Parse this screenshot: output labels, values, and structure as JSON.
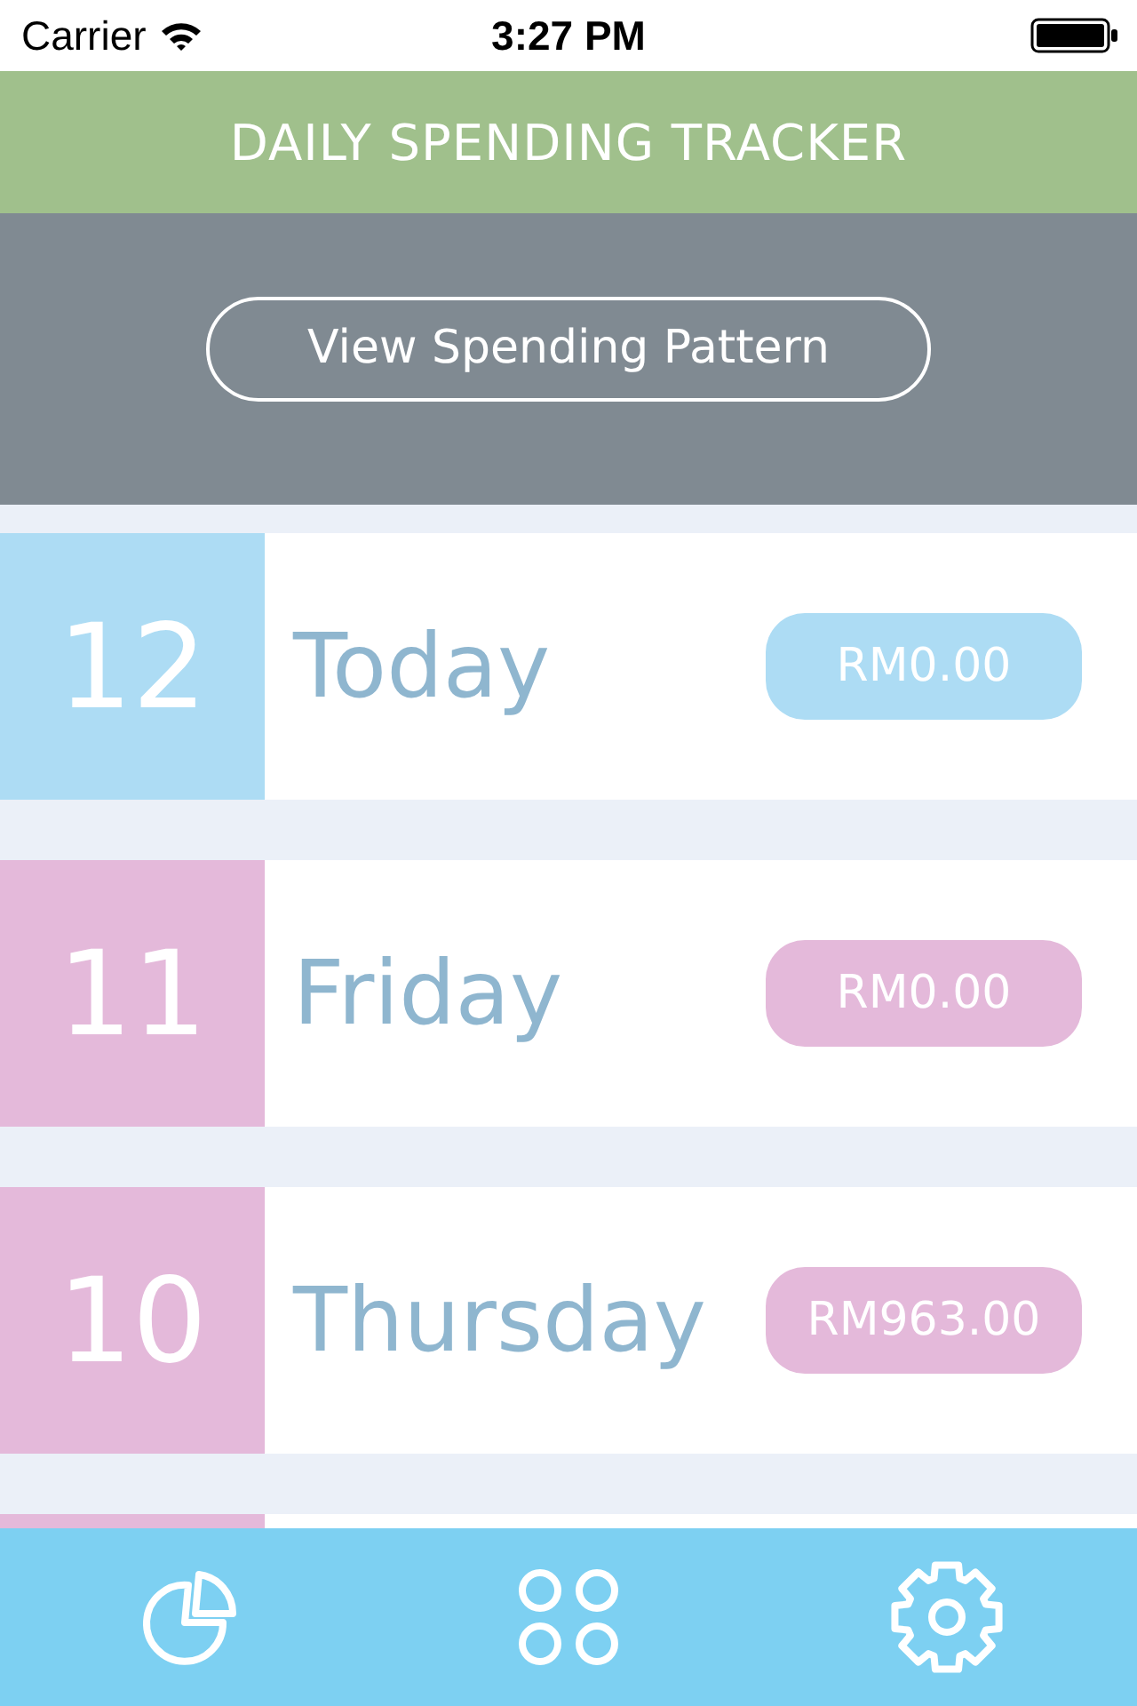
{
  "status_bar": {
    "carrier": "Carrier",
    "time": "3:27 PM"
  },
  "header": {
    "title": "DAILY SPENDING TRACKER"
  },
  "pattern_button": {
    "label": "View Spending Pattern"
  },
  "days": [
    {
      "date": "12",
      "day": "Today",
      "amount": "RM0.00",
      "color": "#addcf4"
    },
    {
      "date": "11",
      "day": "Friday",
      "amount": "RM0.00",
      "color": "#e4b9da"
    },
    {
      "date": "10",
      "day": "Thursday",
      "amount": "RM963.00",
      "color": "#e4b9da"
    },
    {
      "color": "#e4b9da"
    }
  ]
}
